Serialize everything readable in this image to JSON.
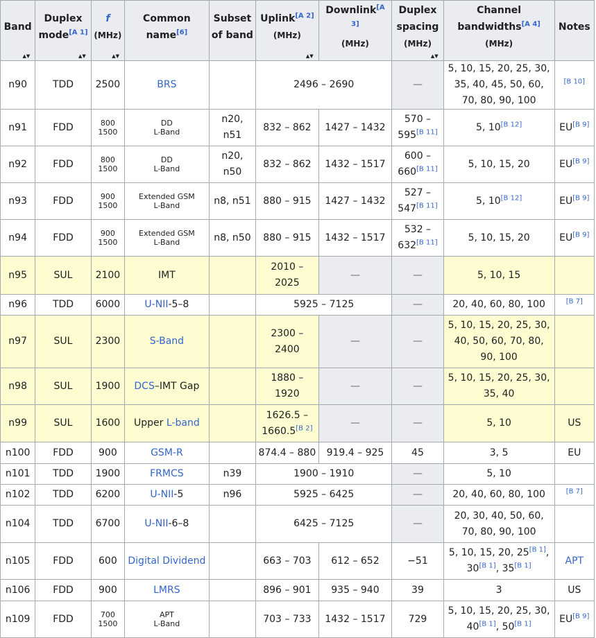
{
  "headers": {
    "band": "Band",
    "duplex_mode": [
      "Duplex",
      "mode"
    ],
    "duplex_mode_ref": "[A 1]",
    "freq_symbol": "f",
    "freq_unit": "(MHz)",
    "common_name": [
      "Common",
      "name"
    ],
    "common_name_ref": "[6]",
    "subset": [
      "Subset",
      "of band"
    ],
    "uplink": "Uplink",
    "uplink_ref": "[A 2]",
    "uplink_unit": "(MHz)",
    "downlink": "Downlink",
    "downlink_ref": "[A 3]",
    "downlink_unit": "(MHz)",
    "duplex_spacing": [
      "Duplex",
      "spacing"
    ],
    "duplex_spacing_unit": "(MHz)",
    "channel_bw": [
      "Channel",
      "bandwidths"
    ],
    "channel_bw_ref": "[A 4]",
    "channel_bw_unit": "(MHz)",
    "notes": "Notes",
    "sort_glyph": "▲▼"
  },
  "rows": {
    "n90": {
      "band": "n90",
      "mode": "TDD",
      "freq": "2500",
      "name": "BRS",
      "span": "2496 – 2690",
      "spacing": "—",
      "bw": "5, 10, 15, 20, 25, 30, 35, 40, 45, 50, 60, 70, 80, 90, 100",
      "note_ref": "[B 10]"
    },
    "n91": {
      "band": "n91",
      "mode": "FDD",
      "freq1": "800",
      "freq2": "1500",
      "name1": "DD",
      "name2": "L-Band",
      "subset": "n20, n51",
      "up": "832 – 862",
      "down": "1427 – 1432",
      "spacing": "570 – 595",
      "spacing_ref": "[B 11]",
      "bw": "5, 10",
      "bw_ref": "[B 12]",
      "note": "EU",
      "note_ref": "[B 9]"
    },
    "n92": {
      "band": "n92",
      "mode": "FDD",
      "freq1": "800",
      "freq2": "1500",
      "name1": "DD",
      "name2": "L-Band",
      "subset": "n20, n50",
      "up": "832 – 862",
      "down": "1432 – 1517",
      "spacing": "600 – 660",
      "spacing_ref": "[B 11]",
      "bw": "5, 10, 15, 20",
      "note": "EU",
      "note_ref": "[B 9]"
    },
    "n93": {
      "band": "n93",
      "mode": "FDD",
      "freq1": "900",
      "freq2": "1500",
      "name1": "Extended GSM",
      "name2": "L-Band",
      "subset": "n8, n51",
      "up": "880 – 915",
      "down": "1427 – 1432",
      "spacing": "527 – 547",
      "spacing_ref": "[B 11]",
      "bw": "5, 10",
      "bw_ref": "[B 12]",
      "note": "EU",
      "note_ref": "[B 9]"
    },
    "n94": {
      "band": "n94",
      "mode": "FDD",
      "freq1": "900",
      "freq2": "1500",
      "name1": "Extended GSM",
      "name2": "L-Band",
      "subset": "n8, n50",
      "up": "880 – 915",
      "down": "1432 – 1517",
      "spacing": "532 – 632",
      "spacing_ref": "[B 11]",
      "bw": "5, 10, 15, 20",
      "note": "EU",
      "note_ref": "[B 9]"
    },
    "n95": {
      "band": "n95",
      "mode": "SUL",
      "freq": "2100",
      "name": "IMT",
      "up": "2010 – 2025",
      "down": "—",
      "spacing": "—",
      "bw": "5, 10, 15"
    },
    "n96": {
      "band": "n96",
      "mode": "TDD",
      "freq": "6000",
      "name_link": "U-NII",
      "name_rest": "-5–8",
      "span": "5925 – 7125",
      "spacing": "—",
      "bw": "20, 40, 60, 80, 100",
      "note_ref": "[B 7]"
    },
    "n97": {
      "band": "n97",
      "mode": "SUL",
      "freq": "2300",
      "name": "S-Band",
      "up": "2300 – 2400",
      "down": "—",
      "spacing": "—",
      "bw": "5, 10, 15, 20, 25, 30, 40, 50, 60, 70, 80, 90, 100"
    },
    "n98": {
      "band": "n98",
      "mode": "SUL",
      "freq": "1900",
      "name_link": "DCS",
      "name_rest": "–IMT Gap",
      "up": "1880 – 1920",
      "down": "—",
      "spacing": "—",
      "bw": "5, 10, 15, 20, 25, 30, 35, 40"
    },
    "n99": {
      "band": "n99",
      "mode": "SUL",
      "freq": "1600",
      "name_pre": "Upper ",
      "name_link": "L-band",
      "up": "1626.5 – 1660.5",
      "up_ref": "[B 2]",
      "down": "—",
      "spacing": "—",
      "bw": "5, 10",
      "note": "US"
    },
    "n100": {
      "band": "n100",
      "mode": "FDD",
      "freq": "900",
      "name": "GSM-R",
      "up": "874.4 – 880",
      "down": "919.4 – 925",
      "spacing": "45",
      "bw": "3, 5",
      "note": "EU"
    },
    "n101": {
      "band": "n101",
      "mode": "TDD",
      "freq": "1900",
      "name": "FRMCS",
      "subset": "n39",
      "span": "1900 – 1910",
      "spacing": "—",
      "bw": "5, 10"
    },
    "n102": {
      "band": "n102",
      "mode": "TDD",
      "freq": "6200",
      "name_link": "U-NII",
      "name_rest": "-5",
      "subset": "n96",
      "span": "5925 – 6425",
      "spacing": "—",
      "bw": "20, 40, 60, 80, 100",
      "note_ref": "[B 7]"
    },
    "n104": {
      "band": "n104",
      "mode": "TDD",
      "freq": "6700",
      "name_link": "U-NII",
      "name_rest": "-6–8",
      "span": "6425 – 7125",
      "spacing": "—",
      "bw": "20, 30, 40, 50, 60, 70, 80, 90, 100"
    },
    "n105": {
      "band": "n105",
      "mode": "FDD",
      "freq": "600",
      "name": "Digital Dividend",
      "up": "663 – 703",
      "down": "612 – 652",
      "spacing": "−51",
      "bw_a": "5, 10, 15, 20, 25",
      "bw_ref_a": "[B 1]",
      "bw_b": ", 30",
      "bw_ref_b": "[B 1]",
      "bw_c": ", 35",
      "bw_ref_c": "[B 1]",
      "note": "APT"
    },
    "n106": {
      "band": "n106",
      "mode": "FDD",
      "freq": "900",
      "name": "LMRS",
      "up": "896 – 901",
      "down": "935 – 940",
      "spacing": "39",
      "bw": "3",
      "note": "US"
    },
    "n109": {
      "band": "n109",
      "mode": "FDD",
      "freq1": "700",
      "freq2": "1500",
      "name1": "APT",
      "name2": "L-Band",
      "up": "703 – 733",
      "down": "1432 – 1517",
      "spacing": "729",
      "bw_a": "5, 10, 15, 20, 25, 30, 40",
      "bw_ref_a": "[B 1]",
      "bw_b": ", 50",
      "bw_ref_b": "[B 1]",
      "note": "EU",
      "note_ref": "[B 9]"
    }
  }
}
